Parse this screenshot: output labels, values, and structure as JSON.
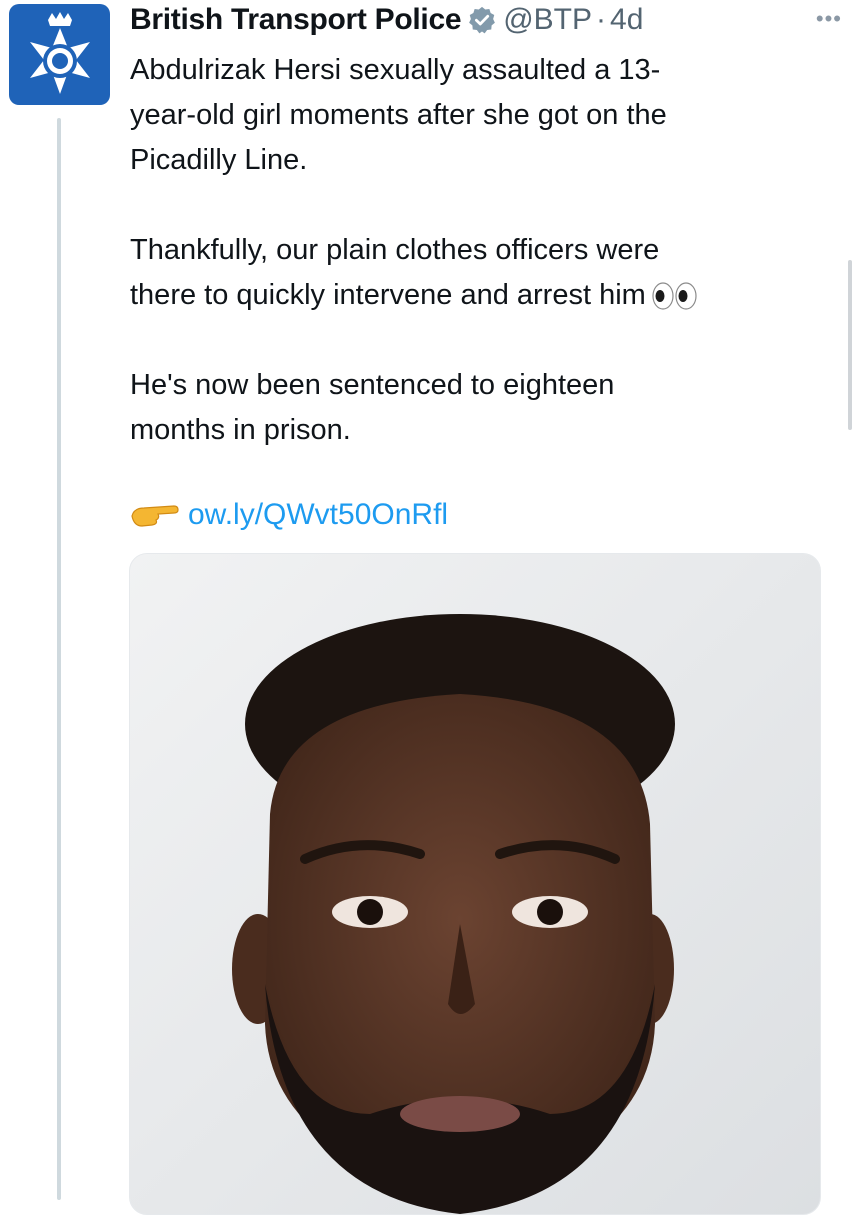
{
  "tweet": {
    "display_name": "British Transport Police",
    "handle": "@BTP",
    "separator": "·",
    "time_ago": "4d",
    "more_label": "•••",
    "paragraphs": {
      "p1_line1": "Abdulrizak Hersi sexually assaulted a 13-",
      "p1_line2": "year-old girl moments after she got on the",
      "p1_line3": "Picadilly Line.",
      "p2_line1": "Thankfully, our plain clothes officers were",
      "p2_line2": "there to quickly intervene and arrest him",
      "p3_line1": "He's now been sentenced to eighteen",
      "p3_line2": "months in prison."
    },
    "link_text": "ow.ly/QWvt50OnRfl",
    "media_alt": "Custody photo"
  },
  "icons": {
    "avatar": "police-crest-icon",
    "verified": "verified-badge-icon",
    "eyes": "eyes-emoji-icon",
    "pointing": "pointing-hand-icon",
    "more": "more-options-icon"
  },
  "colors": {
    "link": "#1d9bf0",
    "secondary_text": "#536471",
    "avatar_bg": "#1f63b8",
    "verified": "#829aab"
  }
}
